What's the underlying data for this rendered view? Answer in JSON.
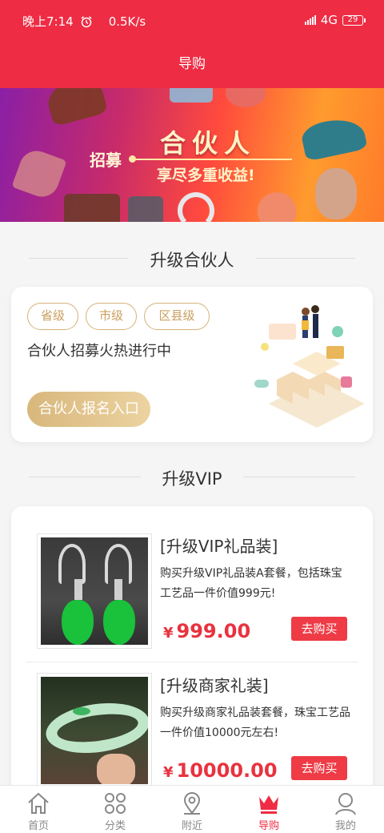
{
  "status_bar": {
    "time": "晚上7:14",
    "net_speed": "0.5K/s",
    "network": "4G",
    "battery": "29"
  },
  "header": {
    "title": "导购"
  },
  "banner": {
    "recruit": "招募",
    "title": "合伙人",
    "subtitle": "享尽多重收益!"
  },
  "partner_section": {
    "heading": "升级合伙人",
    "tags": [
      "省级",
      "市级",
      "区县级"
    ],
    "description": "合伙人招募火热进行中",
    "button_label": "合伙人报名入口"
  },
  "vip_section": {
    "heading": "升级VIP",
    "products": [
      {
        "name": "[升级VIP礼品装]",
        "description": "购买升级VIP礼品装A套餐，包括珠宝工艺品一件价值999元!",
        "currency": "¥",
        "price": "999.00",
        "buy_label": "去购买"
      },
      {
        "name": "[升级商家礼装]",
        "description": "购买升级商家礼品装套餐，珠宝工艺品一件价值10000元左右!",
        "currency": "¥",
        "price": "10000.00",
        "buy_label": "去购买"
      }
    ]
  },
  "tab_bar": {
    "items": [
      {
        "label": "首页",
        "icon": "home-icon"
      },
      {
        "label": "分类",
        "icon": "category-icon"
      },
      {
        "label": "附近",
        "icon": "location-icon"
      },
      {
        "label": "导购",
        "icon": "crown-icon",
        "active": true
      },
      {
        "label": "我的",
        "icon": "user-icon"
      }
    ]
  },
  "colors": {
    "brand_red": "#ee2c44",
    "gold": "#d6b27a",
    "price_red": "#e8333f"
  }
}
